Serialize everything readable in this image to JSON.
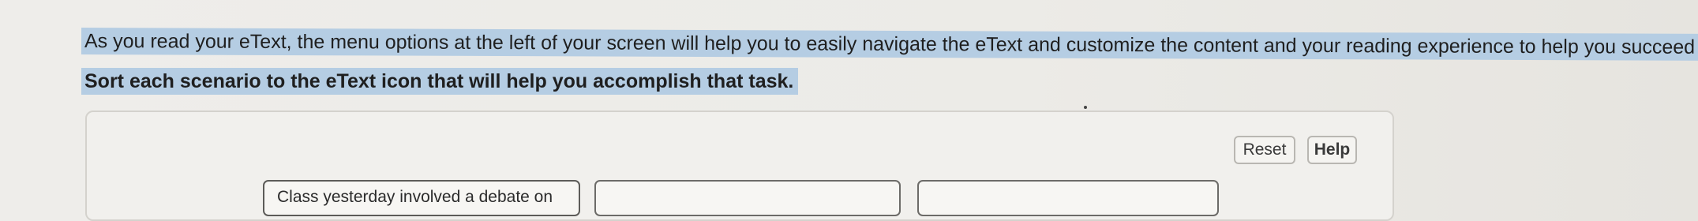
{
  "instructions": {
    "line1": "As you read your eText, the menu options at the left of your screen will help you to easily navigate the eText and customize the content and your reading experience to help you succeed in your",
    "line2": "Sort each scenario to the eText icon that will help you accomplish that task."
  },
  "toolbar": {
    "reset_label": "Reset",
    "help_label": "Help"
  },
  "scenarios": [
    {
      "label": "Class yesterday involved a debate on"
    },
    {
      "label": ""
    },
    {
      "label": ""
    }
  ]
}
